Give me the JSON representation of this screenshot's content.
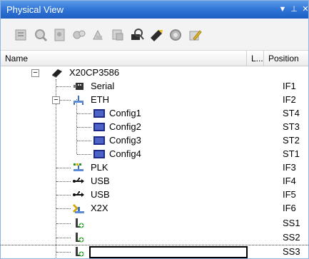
{
  "window": {
    "title": "Physical View",
    "buttons": [
      "dropdown-icon",
      "pin-icon",
      "close-icon"
    ]
  },
  "toolbar": {
    "tools": [
      "open-icon",
      "find-icon",
      "properties-icon",
      "configure-icon",
      "wizard-icon",
      "compare-icon",
      "search-device-icon",
      "connect-icon",
      "settings-icon",
      "edit-icon"
    ]
  },
  "columns": {
    "name": "Name",
    "location": "L...",
    "position": "Position"
  },
  "tree": {
    "root": {
      "label": "X20CP3586",
      "icon": "cpu-icon"
    },
    "items": [
      {
        "label": "Serial",
        "position": "IF1",
        "icon": "serial-port-icon"
      },
      {
        "label": "ETH",
        "position": "IF2",
        "icon": "ethernet-icon"
      },
      {
        "label": "Config1",
        "position": "ST4",
        "icon": "config-icon"
      },
      {
        "label": "Config2",
        "position": "ST3",
        "icon": "config-icon"
      },
      {
        "label": "Config3",
        "position": "ST2",
        "icon": "config-icon"
      },
      {
        "label": "Config4",
        "position": "ST1",
        "icon": "config-icon"
      },
      {
        "label": "PLK",
        "position": "IF3",
        "icon": "powerlink-icon"
      },
      {
        "label": "USB",
        "position": "IF4",
        "icon": "usb-icon"
      },
      {
        "label": "USB",
        "position": "IF5",
        "icon": "usb-icon"
      },
      {
        "label": "X2X",
        "position": "IF6",
        "icon": "x2x-icon"
      },
      {
        "label": "",
        "position": "SS1",
        "icon": "slot-icon"
      },
      {
        "label": "",
        "position": "SS2",
        "icon": "slot-icon"
      },
      {
        "label": "",
        "position": "SS3",
        "icon": "slot-icon",
        "editing": true
      }
    ]
  }
}
